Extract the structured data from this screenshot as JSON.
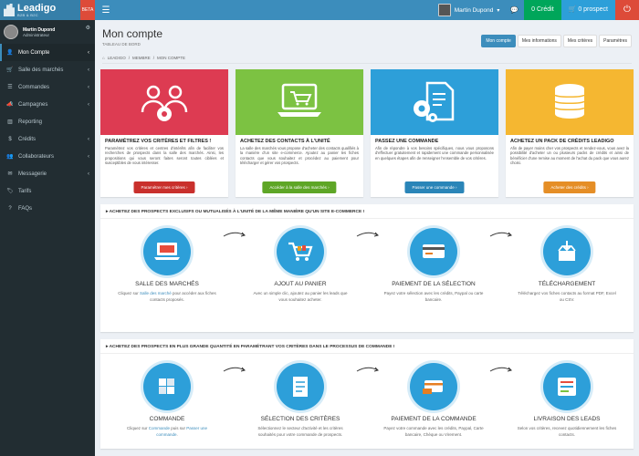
{
  "header": {
    "brand": "Leadigo",
    "brand_sub": "B2B & B2C",
    "beta": "BETA",
    "user_name": "Martin Dupond",
    "credit_label": "0 Crédit",
    "prospect_label": "0 prospect",
    "colors": {
      "topbar": "#3c8dbc",
      "credit": "#00a65a",
      "prospect": "#2d9fd9",
      "logout": "#dd4b39"
    }
  },
  "sidebar": {
    "user_name": "Martin Dupond",
    "user_role": "Administrateur",
    "items": [
      {
        "label": "Mon Compte",
        "icon": "user-icon",
        "arrow": true,
        "active": true
      },
      {
        "label": "Salle des marchés",
        "icon": "cart-icon",
        "arrow": true
      },
      {
        "label": "Commandes",
        "icon": "list-icon",
        "arrow": true
      },
      {
        "label": "Campagnes",
        "icon": "megaphone-icon",
        "arrow": true
      },
      {
        "label": "Reporting",
        "icon": "chart-icon",
        "arrow": false
      },
      {
        "label": "Crédits",
        "icon": "money-icon",
        "arrow": true
      },
      {
        "label": "Collaborateurs",
        "icon": "users-icon",
        "arrow": true
      },
      {
        "label": "Messagerie",
        "icon": "mail-icon",
        "arrow": true
      },
      {
        "label": "Tarifs",
        "icon": "tag-icon",
        "arrow": false
      },
      {
        "label": "FAQs",
        "icon": "question-icon",
        "arrow": false
      }
    ]
  },
  "page": {
    "title": "Mon compte",
    "subtitle": "TABLEAU DE BORD",
    "tabs": [
      "Mon compte",
      "Mes informations",
      "Mes critères",
      "Paramètres"
    ],
    "breadcrumb": [
      "LEADIGO",
      "MEMBRE",
      "MON COMPTE"
    ]
  },
  "cards": [
    {
      "title": "PARAMÉTREZ VOS CRITÈRES ET FILTRES !",
      "text": "Paramétrez vos critères et centres d'intérêts afin de faciliter vos recherches de prospects dans la salle des marchés. Ainsi, les propositions qui vous seront faites seront toutes ciblées et susceptibles de vous intéresser.",
      "button": "Paramétrer mes critères",
      "color": "#dd3b52",
      "btn_color": "#c9302c",
      "icon": "users-gear-icon"
    },
    {
      "title": "ACHETEZ DES CONTACTS À L'UNITÉ",
      "text": "La salle des marchés vous propose d'acheter des contacts qualifiés à la manière d'un site e-commerce. Ajoutez au panier les fiches contacts que vous souhaitez et procédez au paiement pour télécharger et gérer vos prospects.",
      "button": "Accéder à la salle des marchés",
      "color": "#7cc242",
      "btn_color": "#5ea626",
      "icon": "laptop-cart-icon"
    },
    {
      "title": "PASSEZ UNE COMMANDE",
      "text": "Afin de répondre à vos besoins spécifiques, nous vous proposons d'effectuer gratuitement et rapidement une commande personnalisée en quelques étapes afin de renseigner l'ensemble de vos critères.",
      "button": "Passer une commande",
      "color": "#2d9fd9",
      "btn_color": "#2a85b8",
      "icon": "document-gears-icon"
    },
    {
      "title": "ACHETEZ UN PACK DE CRÉDITS LEADIGO",
      "text": "Afin de payer moins cher vos prospects et rendez-vous, vous avez la possibilité d'acheter un ou plusieurs packs de crédits et ainsi de bénéficier d'une remise au moment de l'achat du pack que vous aurez choisi.",
      "button": "Acheter des crédits",
      "color": "#f5b731",
      "btn_color": "#e58e26",
      "icon": "coins-icon"
    }
  ],
  "section1": {
    "title": "ACHETEZ DES PROSPECTS EXCLUSIFS OU MUTUALISÉS À L'UNITÉ DE LA MÊME MANIÈRE QU'UN SITE E-COMMERCE !",
    "steps": [
      {
        "title": "SALLE DES MARCHÉS",
        "pre": "Cliquez sur ",
        "link": "Salle des marché",
        "post": " pour accéder aux fiches contacts proposés.",
        "icon": "laptop-store-icon"
      },
      {
        "title": "AJOUT AU PANIER",
        "pre": "",
        "link": "",
        "post": "Avec un simple clic, ajoutez au panier les leads que vous souhaitez acheter.",
        "icon": "cart-icon"
      },
      {
        "title": "PAIEMENT DE LA SÉLECTION",
        "pre": "",
        "link": "",
        "post": "Payez votre sélection avec les crédits, Paypal ou carte bancaire.",
        "icon": "credit-card-icon"
      },
      {
        "title": "TÉLÉCHARGEMENT",
        "pre": "",
        "link": "",
        "post": "Téléchargez vos fiches contacts au format PDF, Excel ou CSV.",
        "icon": "download-box-icon"
      }
    ]
  },
  "section2": {
    "title": "ACHETEZ DES PROSPECTS EN PLUS GRANDE QUANTITÉ EN PARAMÉTRANT VOS CRITÈRES DANS LE PROCESSUS DE COMMANDE !",
    "steps": [
      {
        "title": "COMMANDE",
        "pre": "Cliquez sur ",
        "link": "Commande",
        "mid": " puis sur ",
        "link2": "Passer une commande",
        "post": ".",
        "icon": "puzzle-icon"
      },
      {
        "title": "SÉLECTION DES CRITÈRES",
        "pre": "",
        "link": "",
        "mid": "",
        "link2": "",
        "post": "Sélectionnez le secteur d'activité et les critères souhaités pour votre commande de prospects.",
        "icon": "checklist-icon"
      },
      {
        "title": "PAIEMENT DE LA COMMANDE",
        "pre": "",
        "link": "",
        "mid": "",
        "link2": "",
        "post": "Payez votre commande avec les crédits, Paypal, Carte bancaire, Chèque ou Virement.",
        "icon": "payment-icon"
      },
      {
        "title": "LIVRAISON DES LEADS",
        "pre": "",
        "link": "",
        "mid": "",
        "link2": "",
        "post": "Selon vos critères, recevez quotidiennement les fiches contacts.",
        "icon": "delivery-icon"
      }
    ]
  }
}
